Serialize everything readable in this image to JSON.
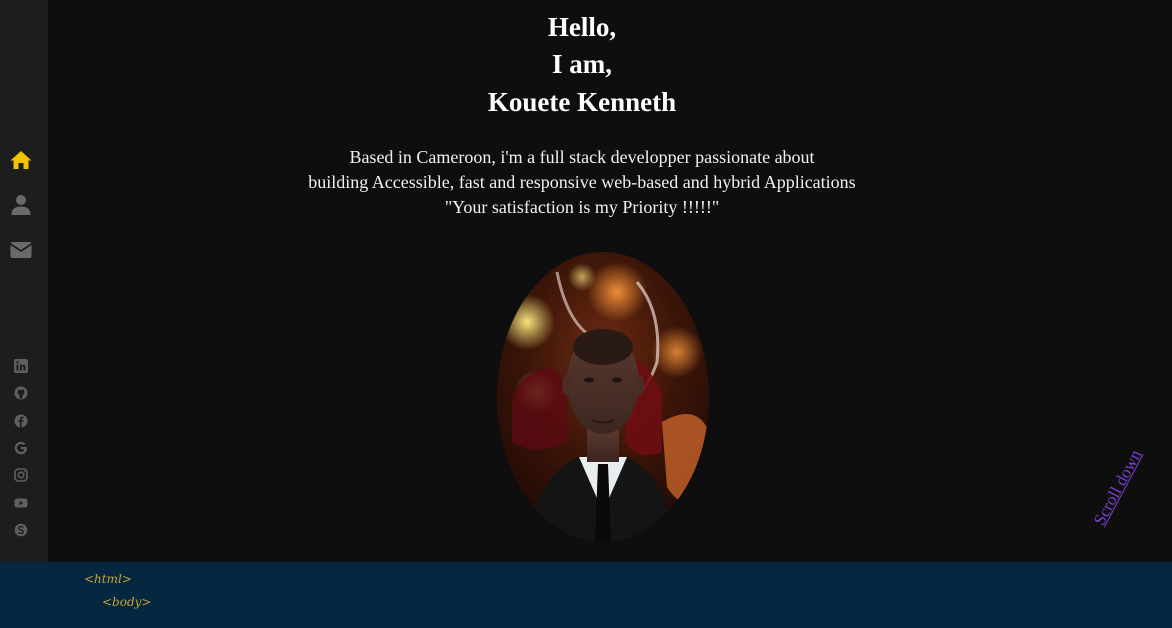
{
  "nav": {
    "items": [
      {
        "icon": "home-icon",
        "active": true
      },
      {
        "icon": "user-icon",
        "active": false
      },
      {
        "icon": "envelope-icon",
        "active": false
      }
    ],
    "active_color": "#f2c200",
    "inactive_color": "#6a6a6a"
  },
  "social": [
    "linkedin-icon",
    "github-icon",
    "facebook-icon",
    "google-icon",
    "instagram-icon",
    "youtube-icon",
    "skype-icon"
  ],
  "hero": {
    "line1": "Hello,",
    "line2": "I am,",
    "line3": "Kouete Kenneth",
    "bio_line1": "Based in Cameroon, i'm a full stack developper passionate about",
    "bio_line2": "building Accessible, fast and responsive web-based and hybrid Applications",
    "bio_line3": "\"Your satisfaction is my Priority !!!!!\""
  },
  "scroll_label": "Scroll down",
  "code_tags": {
    "html": "<html>",
    "body": "<body>"
  },
  "colors": {
    "background": "#0e0e0e",
    "sidebar": "#1d1d1d",
    "footer_band": "#05273f",
    "scroll_link": "#7b3fd0",
    "tag": "#c9a23a"
  }
}
